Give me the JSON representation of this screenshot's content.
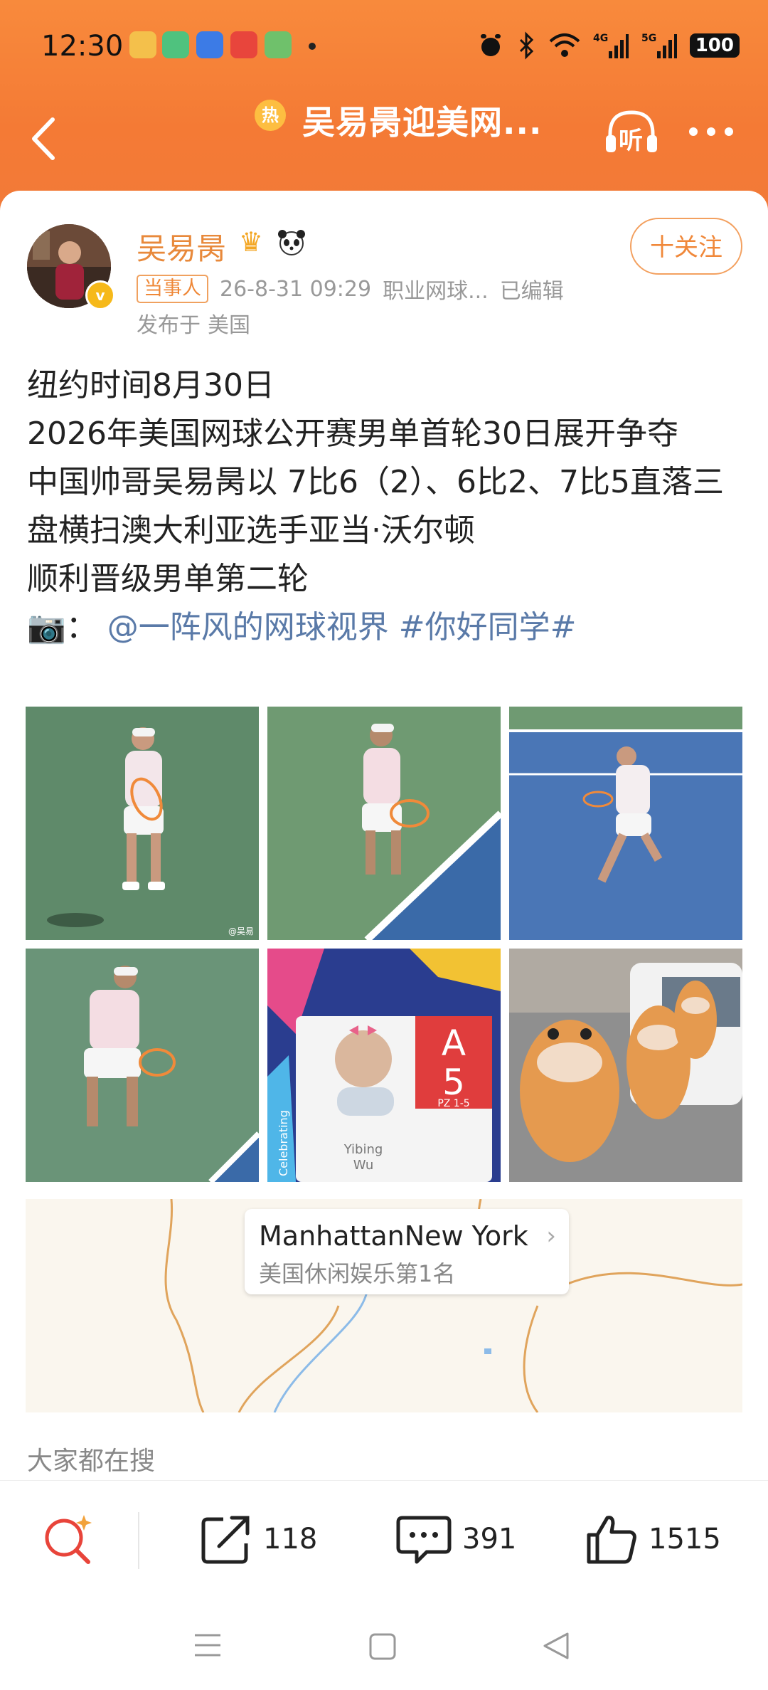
{
  "status_bar": {
    "time": "12:30",
    "battery": "100",
    "icons": [
      "alarm-icon",
      "bluetooth-icon",
      "wifi-icon",
      "signal-4g-icon",
      "signal-5g-icon"
    ]
  },
  "nav": {
    "hot_badge": "热",
    "title": "吴易昺迎美网...",
    "listen_label": "听"
  },
  "post": {
    "author": "吴易昺",
    "follow_label": "十关注",
    "tag": "当事人",
    "datetime": "26-8-31 09:29",
    "source": "职业网球...",
    "edited": "已编辑",
    "posted_from": "发布于",
    "location": "美国",
    "lines": [
      "纽约时间8月30日",
      "2026年美国网球公开赛男单首轮30日展开争夺",
      "中国帅哥吴易昺以 7比6（2）、6比2、7比5直落三盘横扫澳大利亚选手亚当·沃尔顿",
      "顺利晋级男单第二轮"
    ],
    "camera_prefix": "📷：",
    "mention": "@一阵风的网球视界",
    "hashtag": "#你好同学#",
    "photo_watermark": "@吴易",
    "badge_card": {
      "letter": "A",
      "number": "5",
      "zone": "PZ 1-5",
      "name1": "Yibing",
      "name2": "Wu",
      "side": "Celebrating"
    }
  },
  "map": {
    "place": "ManhattanNew York",
    "rank": "美国休闲娱乐第1名"
  },
  "search_label": "大家都在搜",
  "toolbar": {
    "share_count": "118",
    "comment_count": "391",
    "like_count": "1515"
  },
  "colors": {
    "header": "#f47a35",
    "accent": "#ef8838",
    "link": "#5a7aa8"
  }
}
